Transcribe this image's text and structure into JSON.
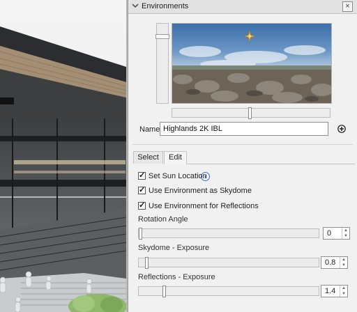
{
  "panel": {
    "title": "Environments",
    "close_icon": "×",
    "collapse_icon": "chevron-down"
  },
  "environment": {
    "name_label": "Name",
    "name_value": "Highlands 2K IBL"
  },
  "tabs": [
    {
      "label": "Select",
      "active": false
    },
    {
      "label": "Edit",
      "active": true
    }
  ],
  "options": {
    "set_sun_location": {
      "label": "Set Sun Location",
      "checked": true
    },
    "use_as_skydome": {
      "label": "Use Environment as Skydome",
      "checked": true
    },
    "use_for_reflections": {
      "label": "Use Environment for Reflections",
      "checked": true
    }
  },
  "rotation": {
    "label": "Rotation Angle",
    "value": "0"
  },
  "skydome_exposure": {
    "label": "Skydome - Exposure",
    "value": "0.8"
  },
  "reflections_exposure": {
    "label": "Reflections - Exposure",
    "value": "1.4"
  },
  "colors": {
    "panel_bg": "#f1f1f1",
    "accent_info": "#3b73c6"
  }
}
